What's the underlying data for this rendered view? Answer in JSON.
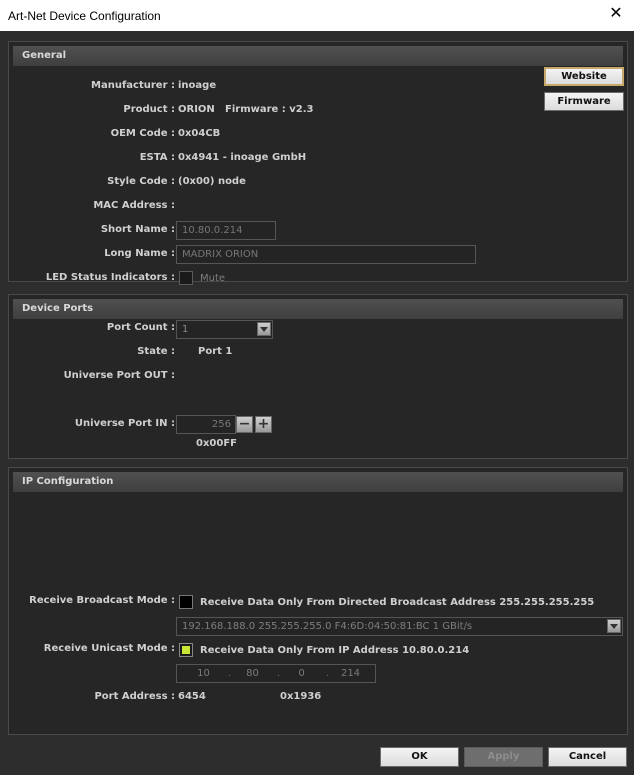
{
  "window": {
    "title": "Art-Net Device Configuration"
  },
  "general": {
    "header": "General",
    "manufacturer_label": "Manufacturer :",
    "manufacturer": "inoage",
    "product_label": "Product :",
    "product": "ORION",
    "firmware_text": "Firmware : v2.3",
    "oem_label": "OEM Code :",
    "oem": "0x04CB",
    "esta_label": "ESTA :",
    "esta": "0x4941 - inoage GmbH",
    "style_label": "Style Code :",
    "style": "(0x00) node",
    "mac_label": "MAC Address :",
    "short_name_label": "Short Name :",
    "short_name": "10.80.0.214",
    "long_name_label": "Long Name :",
    "long_name": "MADRIX ORION",
    "led_label": "LED Status Indicators :",
    "mute_label": "Mute",
    "website_button": "Website",
    "firmware_button": "Firmware"
  },
  "ports": {
    "header": "Device Ports",
    "port_count_label": "Port Count :",
    "port_count": "1",
    "state_label": "State :",
    "state": "Port 1",
    "universe_out_label": "Universe Port OUT :",
    "universe_in_label": "Universe Port IN :",
    "universe_in": "256",
    "universe_in_hex": "0x00FF",
    "minus": "−",
    "plus": "+"
  },
  "ip": {
    "header": "IP Configuration",
    "broadcast_label": "Receive Broadcast Mode :",
    "broadcast_text": "Receive Data Only From Directed Broadcast Address 255.255.255.255",
    "adapter": "192.168.188.0 255.255.255.0 F4:6D:04:50:81:BC 1 GBit/s",
    "unicast_label": "Receive Unicast Mode :",
    "unicast_text": "Receive Data Only From IP Address 10.80.0.214",
    "ip_octets": [
      "10",
      "80",
      "0",
      "214"
    ],
    "port_address_label": "Port Address :",
    "port_address": "6454",
    "port_address_hex": "0x1936"
  },
  "footer": {
    "ok": "OK",
    "apply": "Apply",
    "cancel": "Cancel"
  },
  "colors": {
    "accent_focus": "#c9a96a",
    "unicast_check": "#c8e634"
  },
  "icons": {
    "close": "close-icon",
    "dropdown": "chevron-down-icon"
  }
}
